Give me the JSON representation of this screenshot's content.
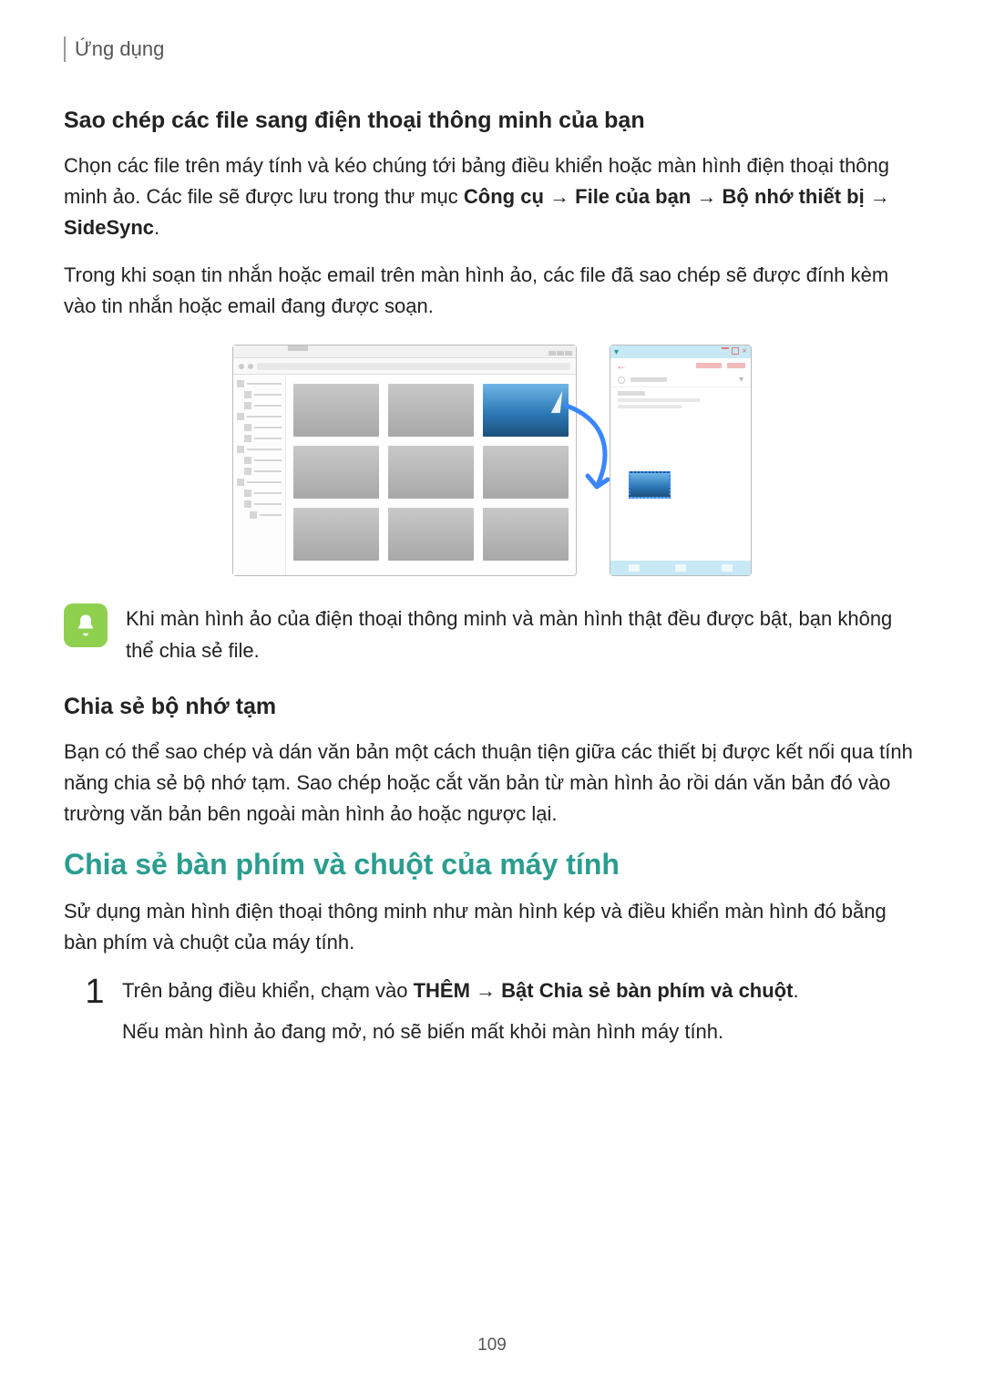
{
  "header": {
    "section": "Ứng dụng"
  },
  "s1": {
    "heading": "Sao chép các file sang điện thoại thông minh của bạn",
    "p1_a": "Chọn các file trên máy tính và kéo chúng tới bảng điều khiển hoặc màn hình điện thoại thông minh ảo. Các file sẽ được lưu trong thư mục ",
    "p1_b1": "Công cụ",
    "arrow": " → ",
    "p1_b2": "File của bạn",
    "p1_b3": "Bộ nhớ thiết bị",
    "p1_b4": "SideSync",
    "p1_end": ".",
    "p2": "Trong khi soạn tin nhắn hoặc email trên màn hình ảo, các file đã sao chép sẽ được đính kèm vào tin nhắn hoặc email đang được soạn."
  },
  "note": {
    "text": "Khi màn hình ảo của điện thoại thông minh và màn hình thật đều được bật, bạn không thể chia sẻ file."
  },
  "s2": {
    "heading": "Chia sẻ bộ nhớ tạm",
    "p": "Bạn có thể sao chép và dán văn bản một cách thuận tiện giữa các thiết bị được kết nối qua tính năng chia sẻ bộ nhớ tạm. Sao chép hoặc cắt văn bản từ màn hình ảo rồi dán văn bản đó vào trường văn bản bên ngoài màn hình ảo hoặc ngược lại."
  },
  "s3": {
    "heading": "Chia sẻ bàn phím và chuột của máy tính",
    "p": "Sử dụng màn hình điện thoại thông minh như màn hình kép và điều khiển màn hình đó bằng bàn phím và chuột của máy tính."
  },
  "step1": {
    "num": "1",
    "l1a": "Trên bảng điều khiển, chạm vào ",
    "l1b1": "THÊM",
    "arrow": " → ",
    "l1b2": "Bật Chia sẻ bàn phím và chuột",
    "l1end": ".",
    "l2": "Nếu màn hình ảo đang mở, nó sẽ biến mất khỏi màn hình máy tính."
  },
  "page_number": "109"
}
